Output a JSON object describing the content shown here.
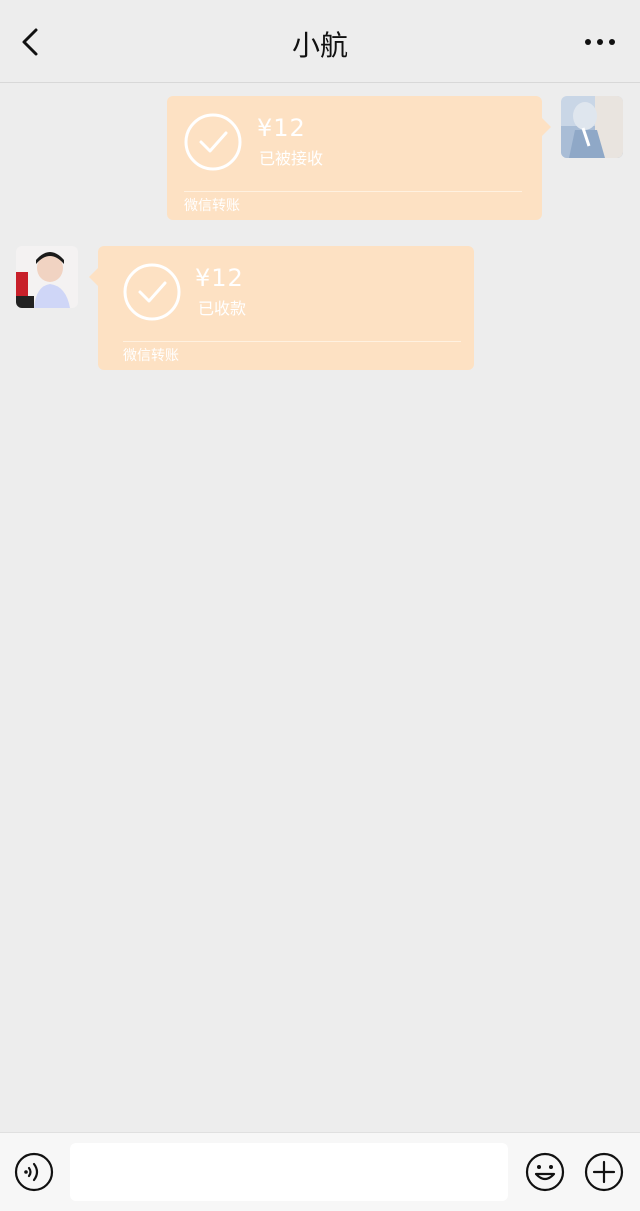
{
  "header": {
    "title": "小航",
    "back_icon": "chevron-left-icon",
    "more_icon": "more-horizontal-icon"
  },
  "messages": [
    {
      "side": "right",
      "amount": "¥12",
      "status": "已被接收",
      "label": "微信转账",
      "avatar": "avatar-self"
    },
    {
      "side": "left",
      "amount": "¥12",
      "status": "已收款",
      "label": "微信转账",
      "avatar": "avatar-contact"
    }
  ],
  "input": {
    "value": "",
    "placeholder": "",
    "voice_icon": "voice-icon",
    "emoji_icon": "emoji-icon",
    "plus_icon": "plus-icon"
  },
  "colors": {
    "transfer_bubble": "#fde1c3",
    "background": "#ededed"
  }
}
